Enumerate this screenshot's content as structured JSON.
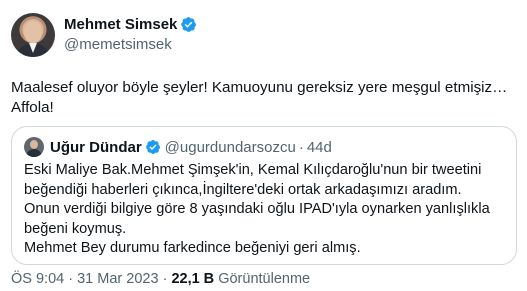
{
  "author": {
    "display_name": "Mehmet Simsek",
    "handle": "@memetsimsek",
    "verified_icon": "verified-badge-icon"
  },
  "tweet": {
    "text": "Maalesef oluyor böyle şeyler! Kamuoyunu gereksiz yere meşgul etmişiz… Affola!"
  },
  "quoted_tweet": {
    "display_name": "Uğur Dündar",
    "handle": "@ugurdundarsozcu",
    "separator": "·",
    "time": "44d",
    "paragraphs": [
      "Eski Maliye Bak.Mehmet Şimşek'in, Kemal Kılıçdaroğlu'nun bir tweetini beğendiği haberleri çıkınca,İngiltere'deki ortak arkadaşımızı aradım.",
      "Onun verdiği bilgiye göre 8 yaşındaki oğlu IPAD'ıyla oynarken yanlışlıkla beğeni koymuş.",
      "Mehmet Bey durumu farkedince beğeniyi geri almış."
    ]
  },
  "meta": {
    "time": "ÖS 9:04",
    "sep1": "·",
    "date": "31 Mar 2023",
    "sep2": "·",
    "views_count": "22,1 B",
    "views_label": "Görüntülenme"
  },
  "colors": {
    "verified": "#1d9bf0",
    "text_primary": "#0f1419",
    "text_secondary": "#536471",
    "border": "#cfd9de"
  }
}
